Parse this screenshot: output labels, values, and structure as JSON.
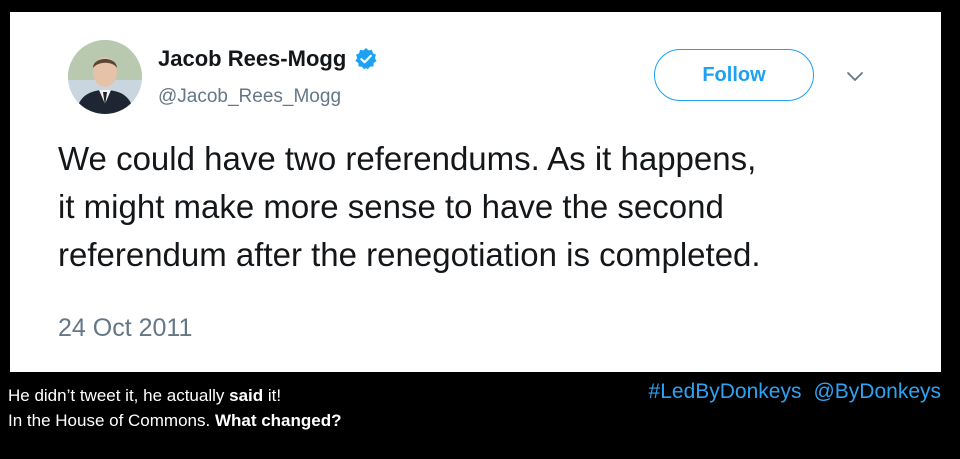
{
  "tweet": {
    "display_name": "Jacob Rees-Mogg",
    "handle": "@Jacob_Rees_Mogg",
    "verified_icon": "verified-badge-icon",
    "follow_label": "Follow",
    "menu_icon": "chevron-down-icon",
    "text_lines": [
      "We could have two referendums. As it happens,",
      "it might make more sense to have the second",
      "referendum after the renegotiation is completed."
    ],
    "date": "24 Oct 2011"
  },
  "caption": {
    "line1_pre": "He didn’t tweet it, he actually ",
    "line1_bold": "said",
    "line1_post": " it!",
    "line2_pre": "In the House of Commons. ",
    "line2_bold": "What changed?"
  },
  "tags": {
    "hashtag": "#LedByDonkeys",
    "account": "@ByDonkeys"
  },
  "colors": {
    "accent": "#1da1f2",
    "secondary_text": "#657786",
    "primary_text": "#14171a",
    "tag_color": "#2ea3f2",
    "background": "#000000"
  }
}
